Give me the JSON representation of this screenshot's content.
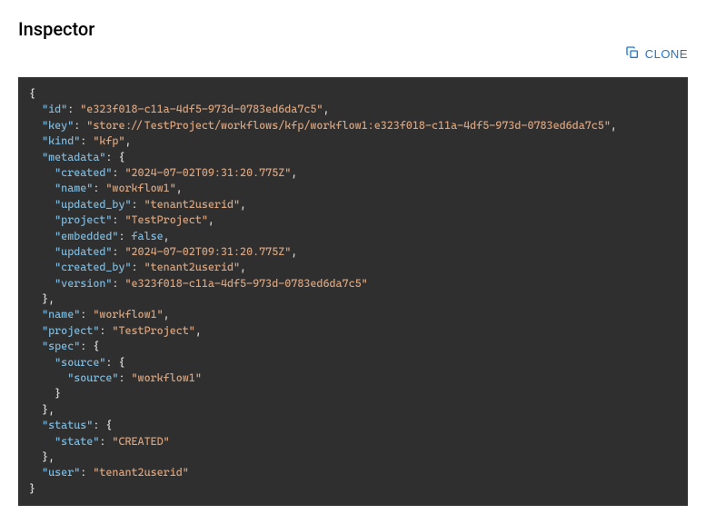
{
  "header": {
    "title": "Inspector",
    "clone_label": "CLONE"
  },
  "json_payload": {
    "id": "e323f018-c11a-4df5-973d-0783ed6da7c5",
    "key": "store://TestProject/workflows/kfp/workflow1:e323f018-c11a-4df5-973d-0783ed6da7c5",
    "kind": "kfp",
    "metadata": {
      "created": "2024-07-02T09:31:20.775Z",
      "name": "workflow1",
      "updated_by": "tenant2userid",
      "project": "TestProject",
      "embedded": false,
      "updated": "2024-07-02T09:31:20.775Z",
      "created_by": "tenant2userid",
      "version": "e323f018-c11a-4df5-973d-0783ed6da7c5"
    },
    "name": "workflow1",
    "project": "TestProject",
    "spec": {
      "source": {
        "source": "workflow1"
      }
    },
    "status": {
      "state": "CREATED"
    },
    "user": "tenant2userid"
  }
}
